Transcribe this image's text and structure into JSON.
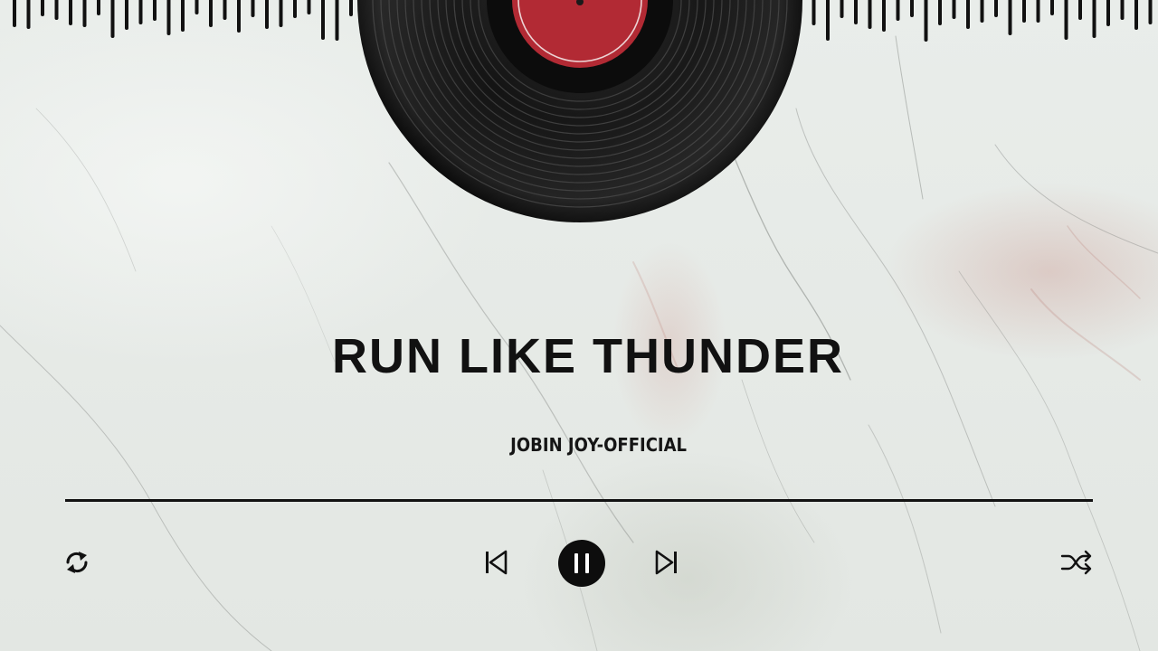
{
  "track": {
    "title": "RUN LIKE THUNDER",
    "artist": "JOBIN JOY-OFFICIAL"
  },
  "player": {
    "progress_fraction": 1.0,
    "state": "playing"
  },
  "controls": {
    "repeat_icon": "repeat-icon",
    "previous_icon": "skip-previous-icon",
    "pause_icon": "pause-icon",
    "next_icon": "skip-next-icon",
    "shuffle_icon": "shuffle-icon"
  },
  "colors": {
    "ink": "#111111",
    "label_red": "#b22a34",
    "background": "#e7ebe8"
  }
}
